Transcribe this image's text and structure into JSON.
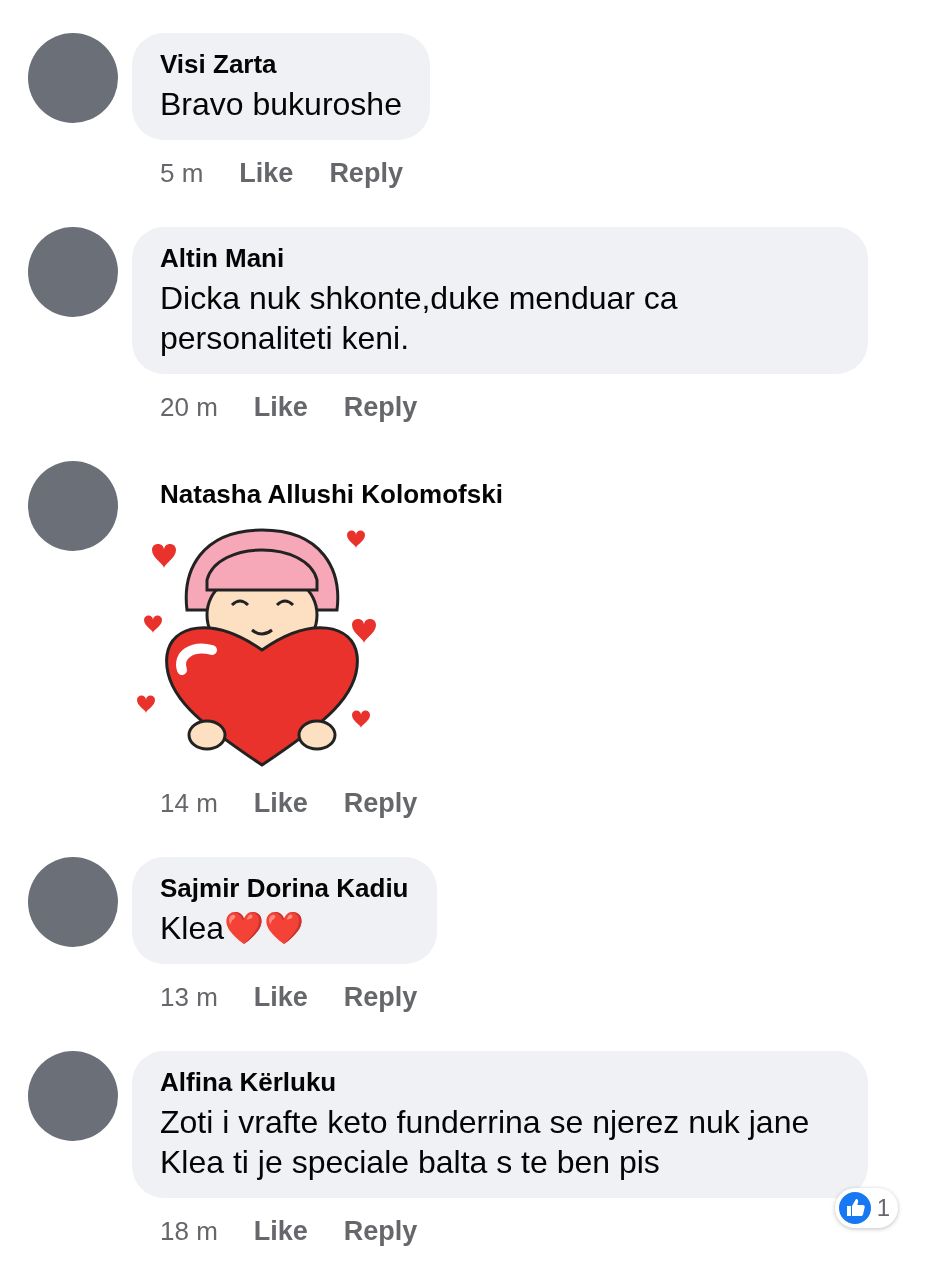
{
  "comments": [
    {
      "kind": "text",
      "author": "Visi Zarta",
      "text": "Bravo bukuroshe",
      "time": "5 m",
      "like": "Like",
      "reply": "Reply"
    },
    {
      "kind": "text",
      "author": "Altin Mani",
      "text": "Dicka nuk shkonte,duke menduar ca personaliteti keni.",
      "time": "20 m",
      "like": "Like",
      "reply": "Reply"
    },
    {
      "kind": "sticker",
      "author": "Natasha Allushi Kolomofski",
      "time": "14 m",
      "like": "Like",
      "reply": "Reply"
    },
    {
      "kind": "text",
      "author": "Sajmir Dorina Kadiu",
      "text": "Klea❤️❤️",
      "time": "13 m",
      "like": "Like",
      "reply": "Reply"
    },
    {
      "kind": "text",
      "author": "Alfina Kërluku",
      "text": "Zoti i vrafte keto funderrina se njerez nuk jane  Klea ti je speciale balta s te ben pis",
      "time": "18 m",
      "like": "Like",
      "reply": "Reply",
      "reactions": "1"
    }
  ]
}
